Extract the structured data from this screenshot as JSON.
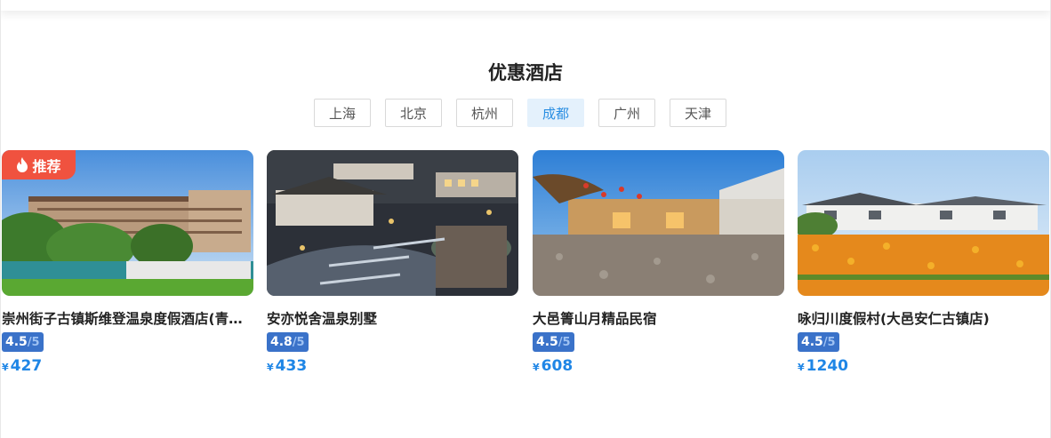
{
  "section": {
    "title": "优惠酒店"
  },
  "tabs": [
    {
      "label": "上海",
      "active": false
    },
    {
      "label": "北京",
      "active": false
    },
    {
      "label": "杭州",
      "active": false
    },
    {
      "label": "成都",
      "active": true
    },
    {
      "label": "广州",
      "active": false
    },
    {
      "label": "天津",
      "active": false
    }
  ],
  "hotels": [
    {
      "name": "崇州街子古镇斯维登温泉度假酒店(青城山店)",
      "badge": "推荐",
      "score": "4.5",
      "out_of": "/5",
      "currency": "¥",
      "price": "427"
    },
    {
      "name": "安亦悦舍温泉别墅",
      "score": "4.8",
      "out_of": "/5",
      "currency": "¥",
      "price": "433"
    },
    {
      "name": "大邑箐山月精品民宿",
      "score": "4.5",
      "out_of": "/5",
      "currency": "¥",
      "price": "608"
    },
    {
      "name": "咏归川度假村(大邑安仁古镇店)",
      "score": "4.5",
      "out_of": "/5",
      "currency": "¥",
      "price": "1240"
    }
  ],
  "colors": {
    "accent": "#1f86e6",
    "badge": "#f0523f",
    "rating": "#3a72c9",
    "tab_active_bg": "#e4f1fc"
  },
  "icons": {
    "badge": "fire-icon"
  }
}
